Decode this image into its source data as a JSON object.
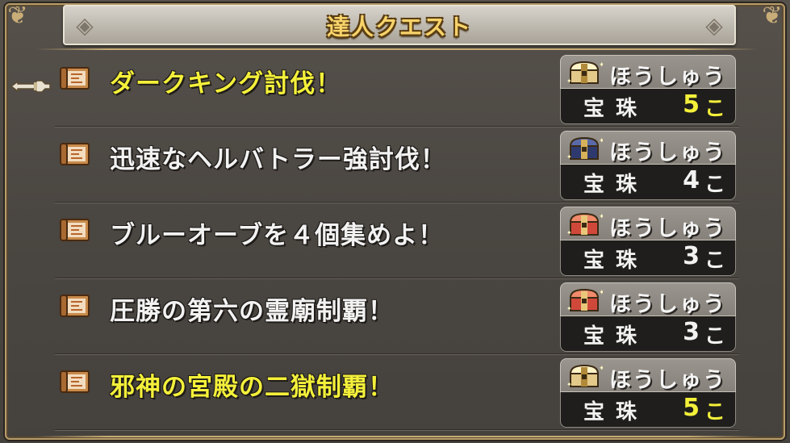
{
  "title": "達人クエスト",
  "quests": [
    {
      "name": "ダークキング討伐！",
      "name_color": "gold",
      "reward_label": "ほうしゅう",
      "reward_item": "宝珠",
      "reward_count": "5",
      "reward_unit": "こ",
      "count_color": "yellow",
      "chest": "gold-chest-icon",
      "selected": true
    },
    {
      "name": "迅速なヘルバトラー強討伐！",
      "name_color": "white",
      "reward_label": "ほうしゅう",
      "reward_item": "宝珠",
      "reward_count": "4",
      "reward_unit": "こ",
      "count_color": "white",
      "chest": "blue-chest-icon",
      "selected": false
    },
    {
      "name": "ブルーオーブを４個集めよ！",
      "name_color": "white",
      "reward_label": "ほうしゅう",
      "reward_item": "宝珠",
      "reward_count": "3",
      "reward_unit": "こ",
      "count_color": "white",
      "chest": "red-chest-icon",
      "selected": false
    },
    {
      "name": "圧勝の第六の霊廟制覇！",
      "name_color": "white",
      "reward_label": "ほうしゅう",
      "reward_item": "宝珠",
      "reward_count": "3",
      "reward_unit": "こ",
      "count_color": "white",
      "chest": "red-chest-icon",
      "selected": false
    },
    {
      "name": "邪神の宮殿の二獄制覇！",
      "name_color": "gold",
      "reward_label": "ほうしゅう",
      "reward_item": "宝珠",
      "reward_count": "5",
      "reward_unit": "こ",
      "count_color": "yellow",
      "chest": "gold-chest-icon",
      "selected": false
    }
  ],
  "colors": {
    "gold_text": "#f4f03a",
    "title_text": "#f7d36a",
    "panel": "#4a4641",
    "frame_gold": "#b89d6a"
  }
}
